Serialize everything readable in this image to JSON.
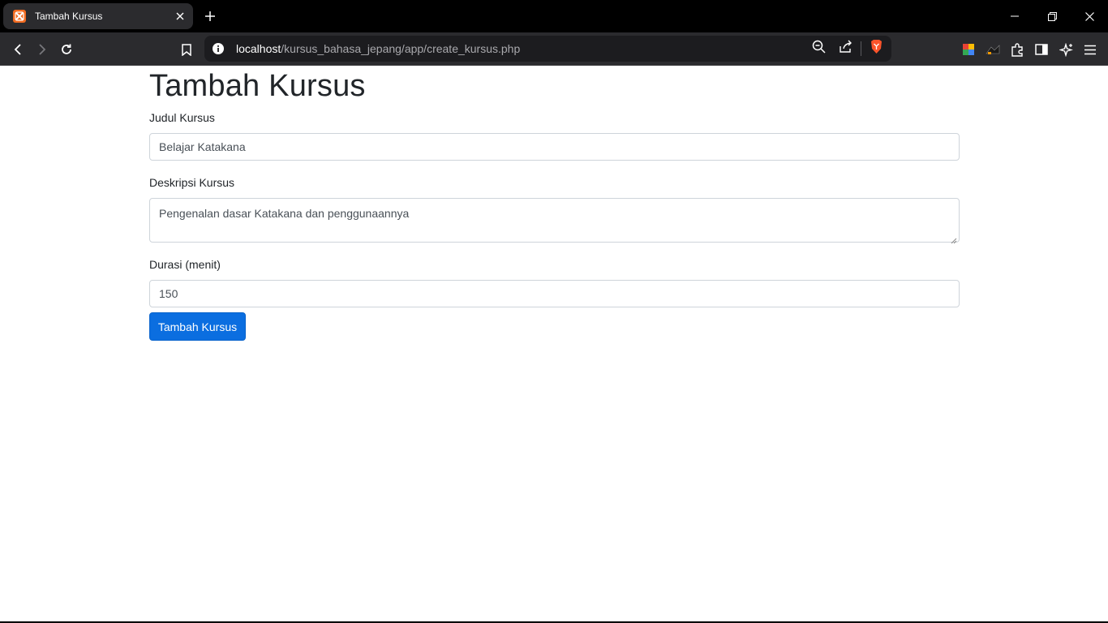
{
  "browser": {
    "tab_title": "Tambah Kursus",
    "favicon_glyph": "꩜",
    "url_host": "localhost",
    "url_path": "/kursus_bahasa_jepang/app/create_kursus.php"
  },
  "page": {
    "heading": "Tambah Kursus",
    "form": {
      "judul_label": "Judul Kursus",
      "judul_value": "Belajar Katakana",
      "deskripsi_label": "Deskripsi Kursus",
      "deskripsi_value": "Pengenalan dasar Katakana dan penggunaannya",
      "durasi_label": "Durasi (menit)",
      "durasi_value": "150",
      "submit_label": "Tambah Kursus"
    }
  },
  "colors": {
    "primary_button": "#0b6ee0",
    "browser_chrome": "#2b2b2e"
  }
}
